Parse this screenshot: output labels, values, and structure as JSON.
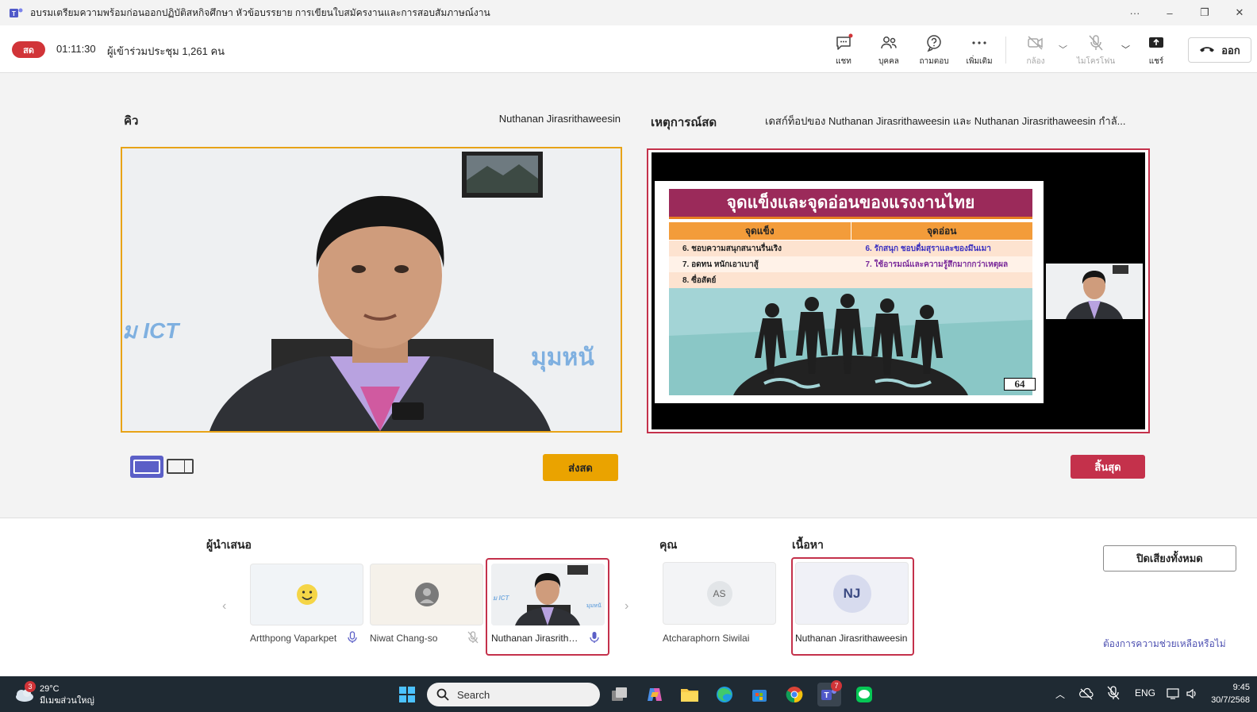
{
  "window": {
    "title": "อบรมเตรียมความพร้อมก่อนออกปฏิบัติสหกิจศึกษา หัวข้อบรรยาย การเขียนใบสมัครงานและการสอบสัมภาษณ์งาน",
    "more": "···",
    "minimize": "–",
    "restore": "❐",
    "close": "✕"
  },
  "meeting": {
    "live_badge": "สด",
    "elapsed": "01:11:30",
    "attendees": "ผู้เข้าร่วมประชุม 1,261 คน",
    "toolbar": {
      "chat": "แชท",
      "people": "บุคคล",
      "qa": "ถามตอบ",
      "more": "เพิ่มเติม",
      "camera": "กล้อง",
      "mic": "ไมโครโฟน",
      "share": "แชร์",
      "leave": "ออก"
    }
  },
  "stage": {
    "queue": {
      "title": "คิว",
      "presenter": "Nuthanan Jirasrithaweesin",
      "send_live": "ส่งสด",
      "wall_text_left": "ม ICT",
      "wall_text_right": "มุมหนั"
    },
    "live": {
      "title": "เหตุการณ์สด",
      "subtitle": "เดสก์ท็อปของ Nuthanan Jirasrithaweesin และ Nuthanan Jirasrithaweesin กำลั...",
      "end": "สิ้นสุด"
    },
    "slide": {
      "title": "จุดแข็งและจุดอ่อนของแรงงานไทย",
      "col_strength": "จุดแข็ง",
      "col_weakness": "จุดอ่อน",
      "strengths": [
        "6. ชอบความสนุกสนานรื่นเริง",
        "7. อดทน หนักเอาเบาสู้",
        "8. ซื่อสัตย์"
      ],
      "weaknesses": [
        "6. รักสนุก ชอบดื่มสุราและของมึนเมา",
        "7. ใช้อารมณ์และความรู้สึกมากกว่าเหตุผล",
        ""
      ],
      "page_number": "64"
    }
  },
  "bottom": {
    "presenters_title": "ผู้นำเสนอ",
    "you_title": "คุณ",
    "content_title": "เนื้อหา",
    "presenters": [
      {
        "name": "Artthpong Vaparkpet"
      },
      {
        "name": "Niwat Chang-so"
      },
      {
        "name": "Nuthanan Jirasritha..."
      }
    ],
    "you": {
      "initials": "AS",
      "name": "Atcharaphorn Siwilai"
    },
    "content": {
      "initials": "NJ",
      "name": "Nuthanan Jirasrithaweesin"
    },
    "mute_all": "ปิดเสียงทั้งหมด",
    "help": "ต้องการความช่วยเหลือหรือไม่",
    "prev": "‹",
    "next": "›"
  },
  "taskbar": {
    "weather_badge": "3",
    "temp": "29°C",
    "weather_desc": "มีเมฆส่วนใหญ่",
    "search": "Search",
    "teams_badge": "7",
    "lang": "ENG",
    "time": "9:45",
    "date": "30/7/2568"
  }
}
